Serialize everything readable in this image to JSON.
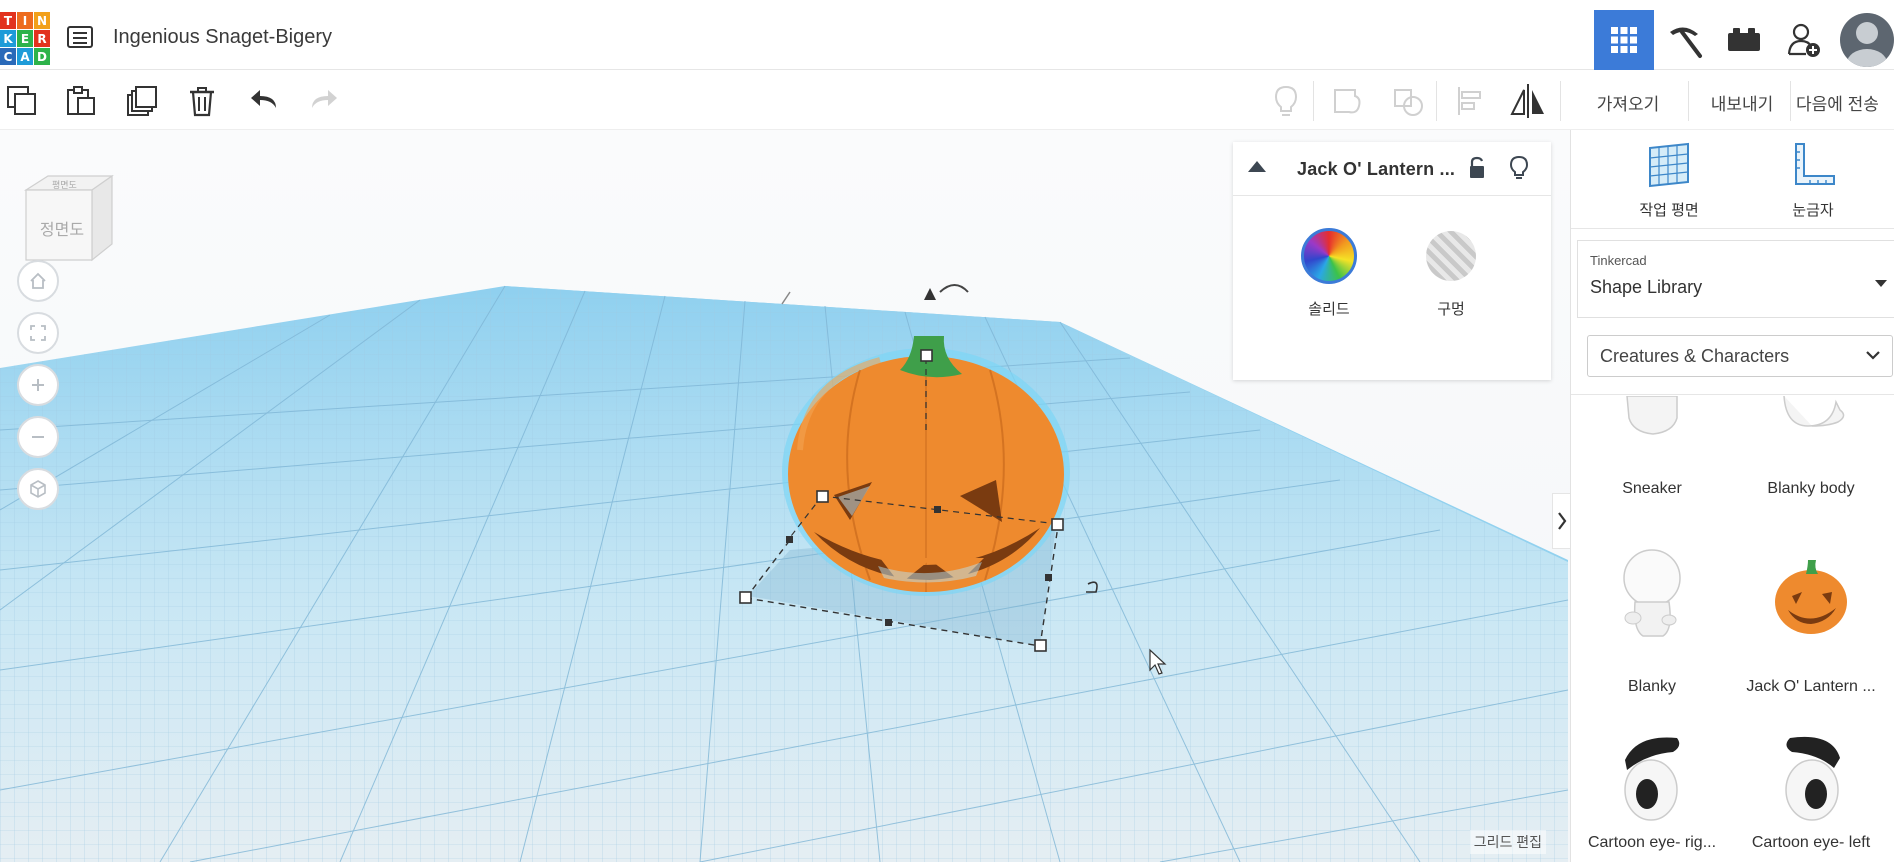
{
  "app": {
    "logo_letters": [
      "T",
      "I",
      "N",
      "K",
      "E",
      "R",
      "C",
      "A",
      "D"
    ],
    "logo_colors": [
      "#e2321e",
      "#ed6b1e",
      "#f2a01a",
      "#1e9bd8",
      "#2db34a",
      "#e2321e",
      "#2a6ab9",
      "#1e9bd8",
      "#2db34a"
    ],
    "design_title": "Ingenious Snaget-Bigery"
  },
  "topnav": {
    "items": [
      {
        "name": "3d-design-grid-icon",
        "active": true
      },
      {
        "name": "pickaxe-icon",
        "active": false
      },
      {
        "name": "bricks-icon",
        "active": false
      },
      {
        "name": "add-user-icon",
        "active": false
      }
    ]
  },
  "toolbar": {
    "import_label": "가져오기",
    "export_label": "내보내기",
    "send_to_label": "다음에 전송"
  },
  "viewcube": {
    "face_label": "정면도",
    "top_label": "평면도"
  },
  "workspace": {
    "edit_grid_label": "그리드 편집"
  },
  "inspector": {
    "title": "Jack O' Lantern ...",
    "solid_label": "솔리드",
    "hole_label": "구멍",
    "accent": "#3c7bd8"
  },
  "rightpanel": {
    "workplane_label": "작업 평면",
    "ruler_label": "눈금자",
    "library_provider": "Tinkercad",
    "library_name": "Shape Library",
    "category": "Creatures & Characters",
    "shapes": [
      {
        "label": "Sneaker",
        "icon": "sneaker-shape"
      },
      {
        "label": "Blanky body",
        "icon": "blanky-body-shape"
      },
      {
        "label": "Blanky",
        "icon": "blanky-shape"
      },
      {
        "label": "Jack O' Lantern ...",
        "icon": "pumpkin-shape"
      },
      {
        "label": "Cartoon eye- rig...",
        "icon": "cartoon-eye-right-shape"
      },
      {
        "label": "Cartoon eye- left",
        "icon": "cartoon-eye-left-shape"
      }
    ]
  }
}
